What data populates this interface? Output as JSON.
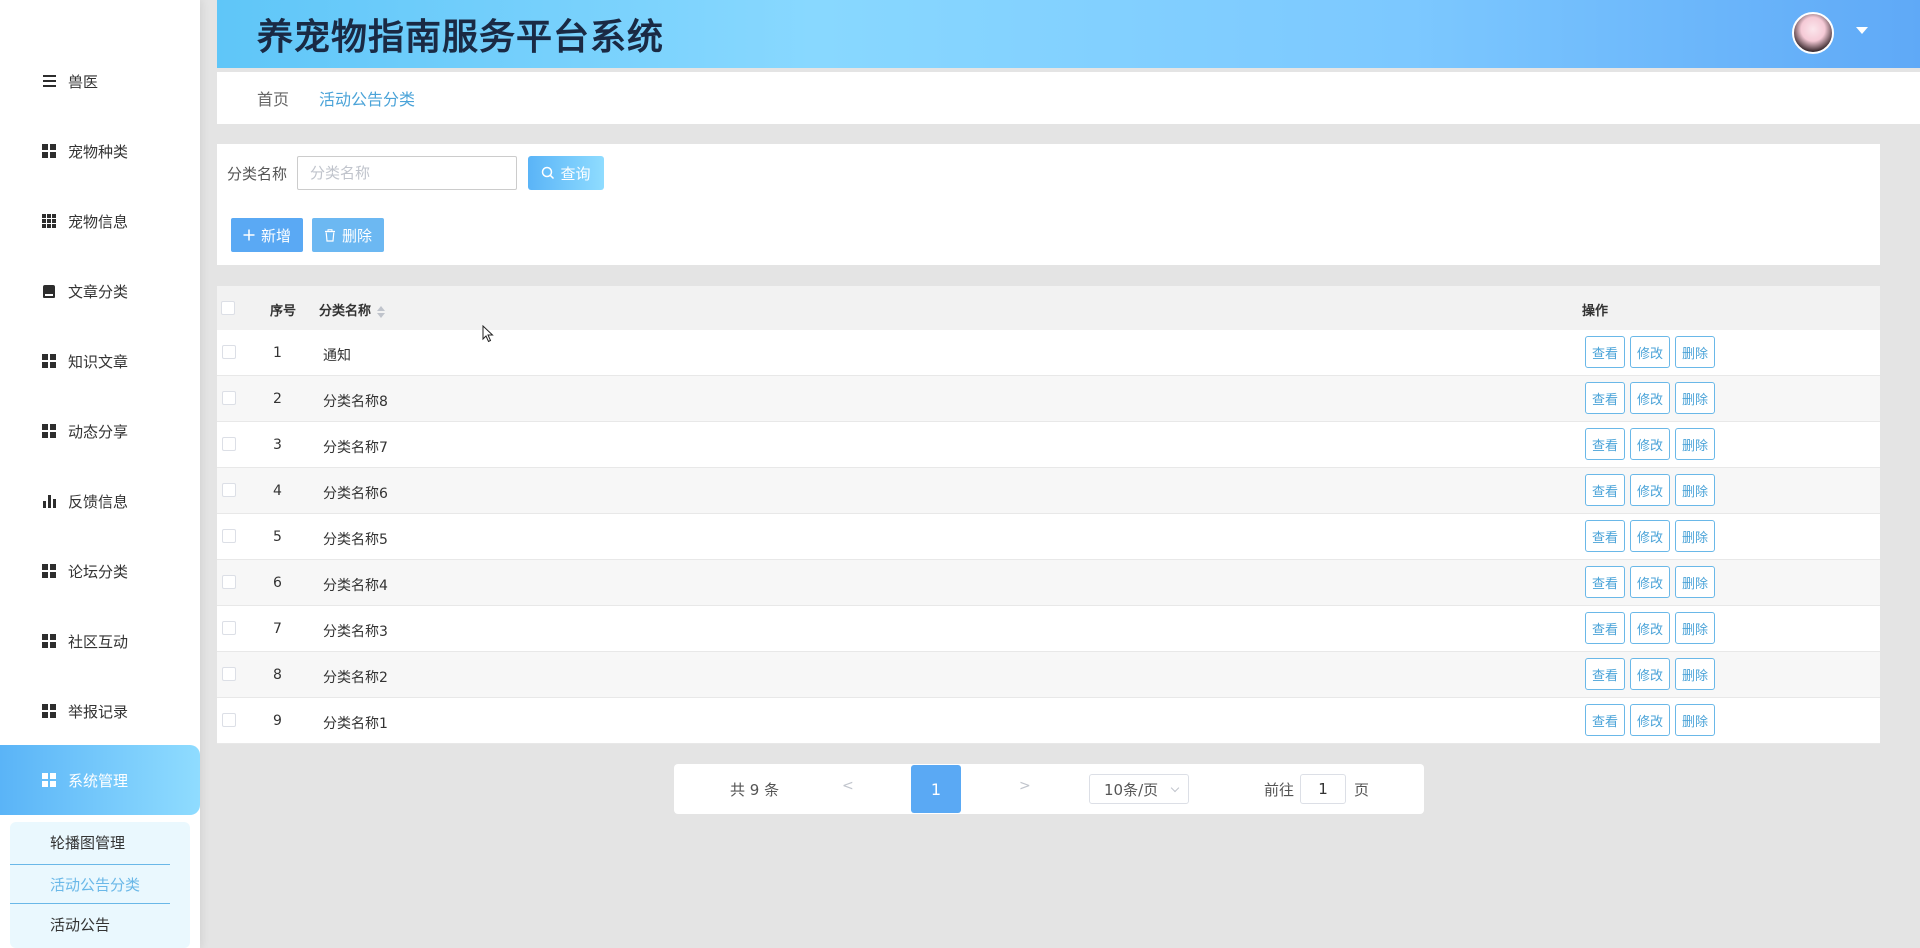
{
  "app": {
    "title": "养宠物指南服务平台系统"
  },
  "sidebar": {
    "items": [
      {
        "label": "兽医",
        "icon": "list-icon"
      },
      {
        "label": "宠物种类",
        "icon": "grid-icon"
      },
      {
        "label": "宠物信息",
        "icon": "grid-nine-icon"
      },
      {
        "label": "文章分类",
        "icon": "book-icon"
      },
      {
        "label": "知识文章",
        "icon": "grid-icon"
      },
      {
        "label": "动态分享",
        "icon": "grid-icon"
      },
      {
        "label": "反馈信息",
        "icon": "bar-chart-icon"
      },
      {
        "label": "论坛分类",
        "icon": "grid-icon"
      },
      {
        "label": "社区互动",
        "icon": "grid-icon"
      },
      {
        "label": "举报记录",
        "icon": "grid-icon"
      },
      {
        "label": "系统管理",
        "icon": "grid-icon",
        "active": true
      }
    ],
    "submenu": [
      {
        "label": "轮播图管理"
      },
      {
        "label": "活动公告分类",
        "active": true
      },
      {
        "label": "活动公告"
      }
    ]
  },
  "breadcrumb": {
    "home": "首页",
    "current": "活动公告分类"
  },
  "search": {
    "label": "分类名称",
    "placeholder": "分类名称",
    "value": "",
    "query_label": "查询",
    "add_label": "新增",
    "delete_label": "删除"
  },
  "table": {
    "headers": {
      "index": "序号",
      "name": "分类名称",
      "actions": "操作"
    },
    "action_labels": {
      "view": "查看",
      "edit": "修改",
      "delete": "删除"
    },
    "rows": [
      {
        "index": "1",
        "name": "通知"
      },
      {
        "index": "2",
        "name": "分类名称8"
      },
      {
        "index": "3",
        "name": "分类名称7"
      },
      {
        "index": "4",
        "name": "分类名称6"
      },
      {
        "index": "5",
        "name": "分类名称5"
      },
      {
        "index": "6",
        "name": "分类名称4"
      },
      {
        "index": "7",
        "name": "分类名称3"
      },
      {
        "index": "8",
        "name": "分类名称2"
      },
      {
        "index": "9",
        "name": "分类名称1"
      }
    ]
  },
  "pagination": {
    "total_text": "共 9 条",
    "prev": "<",
    "current_page": "1",
    "next": ">",
    "page_size": "10条/页",
    "goto_label": "前往",
    "goto_value": "1",
    "page_unit": "页"
  },
  "colors": {
    "accent": "#5aa9f4",
    "header_gradient_start": "#5fc6f8",
    "header_gradient_end": "#5fa9f7",
    "link": "#4aa3d8"
  }
}
